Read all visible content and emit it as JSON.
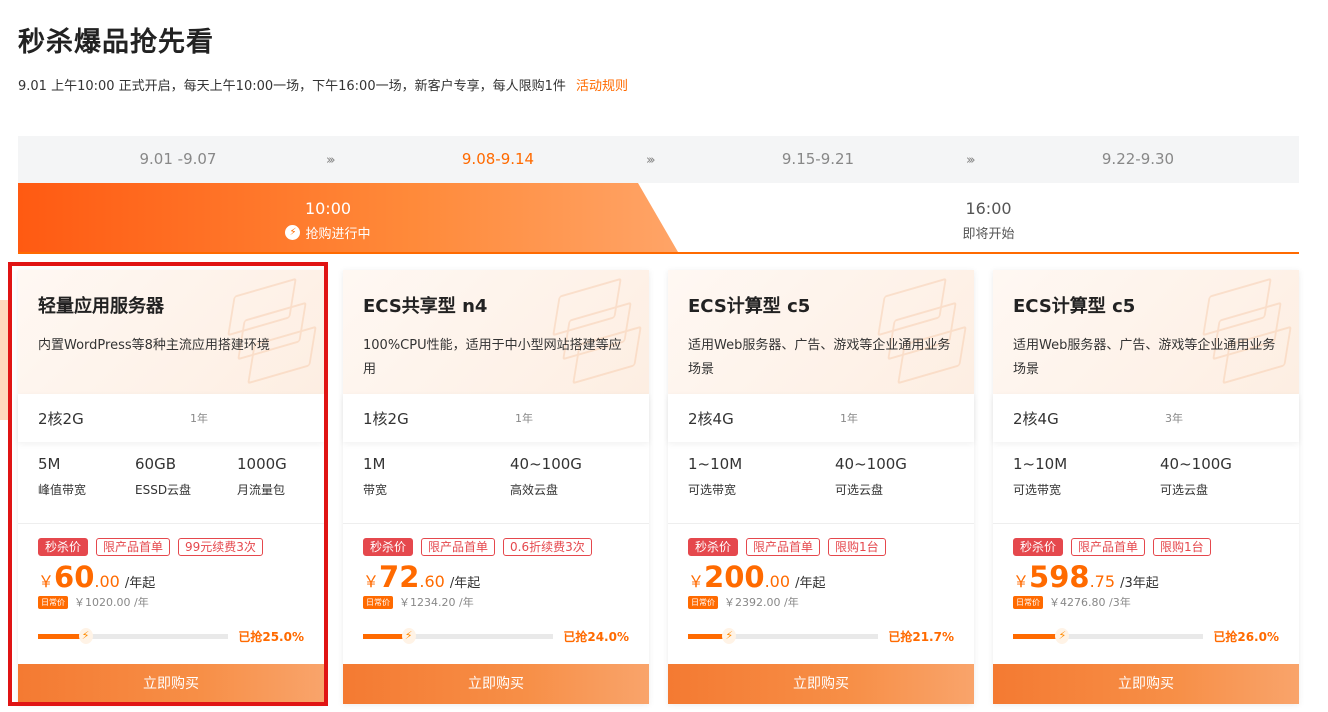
{
  "header": {
    "title": "秒杀爆品抢先看",
    "subtitle": "9.01 上午10:00 正式开启，每天上午10:00一场，下午16:00一场，新客户专享，每人限购1件",
    "rules_link": "活动规则"
  },
  "weeks": [
    {
      "label": "9.01 -9.07",
      "active": false
    },
    {
      "label": "9.08-9.14",
      "active": true
    },
    {
      "label": "9.15-9.21",
      "active": false
    },
    {
      "label": "9.22-9.30",
      "active": false
    }
  ],
  "week_arrow": "›››",
  "time_slots": [
    {
      "time": "10:00",
      "status": "抢购进行中",
      "active": true
    },
    {
      "time": "16:00",
      "status": "即将开始",
      "active": false
    }
  ],
  "cards": [
    {
      "title": "轻量应用服务器",
      "desc": "内置WordPress等8种主流应用搭建环境",
      "spec": "2核2G",
      "term": "1年",
      "features": [
        {
          "value": "5M",
          "label": "峰值带宽"
        },
        {
          "value": "60GB",
          "label": "ESSD云盘"
        },
        {
          "value": "1000G",
          "label": "月流量包"
        }
      ],
      "tags": [
        "秒杀价",
        "限产品首单",
        "99元续费3次"
      ],
      "currency": "￥",
      "price_int": "60",
      "price_dec": ".00",
      "price_unit": "/年起",
      "orig_tag": "日常价",
      "orig_price": "￥1020.00 /年",
      "progress": 25.0,
      "progress_text": "已抢25.0%",
      "buy": "立即购买"
    },
    {
      "title": "ECS共享型 n4",
      "desc": "100%CPU性能，适用于中小型网站搭建等应用",
      "spec": "1核2G",
      "term": "1年",
      "features": [
        {
          "value": "1M",
          "label": "带宽"
        },
        {
          "value": "40~100G",
          "label": "高效云盘"
        }
      ],
      "tags": [
        "秒杀价",
        "限产品首单",
        "0.6折续费3次"
      ],
      "currency": "￥",
      "price_int": "72",
      "price_dec": ".60",
      "price_unit": "/年起",
      "orig_tag": "日常价",
      "orig_price": "￥1234.20 /年",
      "progress": 24.0,
      "progress_text": "已抢24.0%",
      "buy": "立即购买"
    },
    {
      "title": "ECS计算型 c5",
      "desc": "适用Web服务器、广告、游戏等企业通用业务场景",
      "spec": "2核4G",
      "term": "1年",
      "features": [
        {
          "value": "1~10M",
          "label": "可选带宽"
        },
        {
          "value": "40~100G",
          "label": "可选云盘"
        }
      ],
      "tags": [
        "秒杀价",
        "限产品首单",
        "限购1台"
      ],
      "currency": "￥",
      "price_int": "200",
      "price_dec": ".00",
      "price_unit": "/年起",
      "orig_tag": "日常价",
      "orig_price": "￥2392.00 /年",
      "progress": 21.7,
      "progress_text": "已抢21.7%",
      "buy": "立即购买"
    },
    {
      "title": "ECS计算型 c5",
      "desc": "适用Web服务器、广告、游戏等企业通用业务场景",
      "spec": "2核4G",
      "term": "3年",
      "features": [
        {
          "value": "1~10M",
          "label": "可选带宽"
        },
        {
          "value": "40~100G",
          "label": "可选云盘"
        }
      ],
      "tags": [
        "秒杀价",
        "限产品首单",
        "限购1台"
      ],
      "currency": "￥",
      "price_int": "598",
      "price_dec": ".75",
      "price_unit": "/3年起",
      "orig_tag": "日常价",
      "orig_price": "￥4276.80 /3年",
      "progress": 26.0,
      "progress_text": "已抢26.0%",
      "buy": "立即购买"
    }
  ],
  "colors": {
    "accent": "#ff6a00",
    "tag_red": "#e5484d",
    "highlight": "#e01414"
  }
}
